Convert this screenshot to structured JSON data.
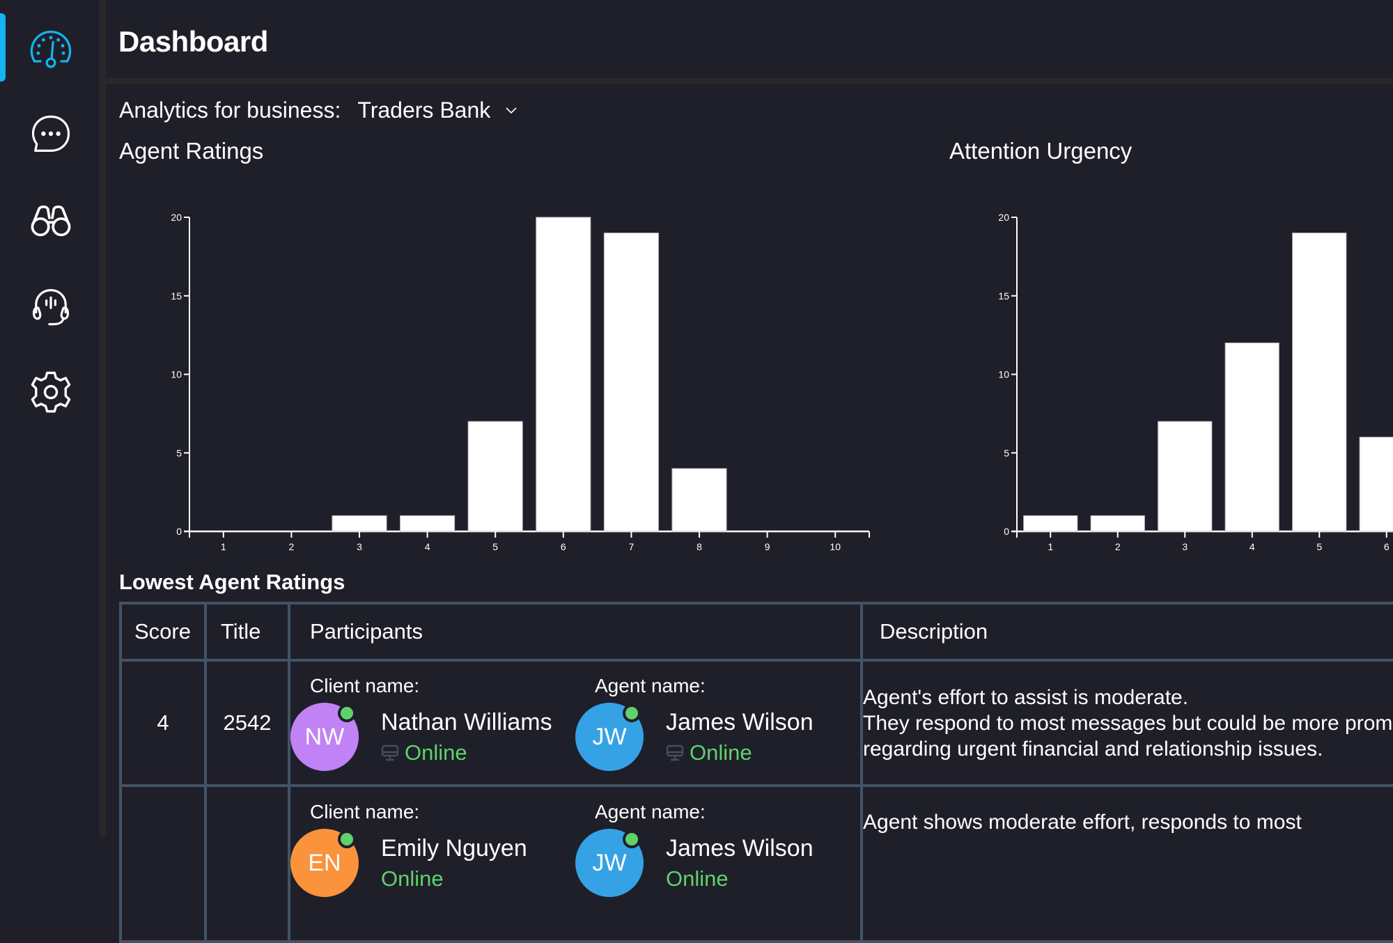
{
  "sidebar": {
    "items": [
      {
        "name": "dashboard",
        "icon": "speedometer-icon",
        "active": true
      },
      {
        "name": "chats",
        "icon": "chat-bubble-icon",
        "active": false
      },
      {
        "name": "monitor",
        "icon": "binoculars-icon",
        "active": false
      },
      {
        "name": "agents",
        "icon": "headset-icon",
        "active": false
      },
      {
        "name": "settings",
        "icon": "gear-icon",
        "active": false
      }
    ],
    "accent_color": "#12b5ef"
  },
  "header": {
    "title": "Dashboard"
  },
  "business": {
    "label": "Analytics for business:",
    "selected": "Traders Bank"
  },
  "charts": {
    "agent_ratings_title": "Agent Ratings",
    "attention_urgency_title": "Attention Urgency"
  },
  "chart_data": [
    {
      "type": "bar",
      "title": "Agent Ratings",
      "categories": [
        "1",
        "2",
        "3",
        "4",
        "5",
        "6",
        "7",
        "8",
        "9",
        "10"
      ],
      "values": [
        0,
        0,
        1,
        1,
        7,
        20,
        19,
        4,
        0,
        0
      ],
      "xlabel": "",
      "ylabel": "",
      "ylim": [
        0,
        20
      ],
      "yticks": [
        0,
        5,
        10,
        15,
        20
      ],
      "grid": false,
      "bar_color": "#ffffff"
    },
    {
      "type": "bar",
      "title": "Attention Urgency",
      "categories": [
        "1",
        "2",
        "3",
        "4",
        "5",
        "6"
      ],
      "values": [
        1,
        1,
        7,
        12,
        19,
        6
      ],
      "xlabel": "",
      "ylabel": "",
      "ylim": [
        0,
        20
      ],
      "yticks": [
        0,
        5,
        10,
        15,
        20
      ],
      "grid": false,
      "bar_color": "#ffffff",
      "note": "chart truncated at right edge; only categories 1-6 visible"
    }
  ],
  "table": {
    "title": "Lowest Agent Ratings",
    "columns": [
      "Score",
      "Title",
      "Participants",
      "Description"
    ],
    "client_label": "Client name:",
    "agent_label": "Agent name:",
    "rows": [
      {
        "score": "4",
        "title": "2542",
        "client": {
          "name": "Nathan Williams",
          "initials": "NW",
          "color": "#c182f6",
          "status": "Online"
        },
        "agent": {
          "name": "James Wilson",
          "initials": "JW",
          "color": "#35a2e6",
          "status": "Online"
        },
        "description": "Agent's effort to assist is moderate.\nThey respond to most messages but could be more prompt, especially regarding urgent financial and relationship issues."
      },
      {
        "score": "",
        "title": "",
        "client": {
          "name": "Emily Nguyen",
          "initials": "EN",
          "color": "#fb923c",
          "status": "Online"
        },
        "agent": {
          "name": "James Wilson",
          "initials": "JW",
          "color": "#35a2e6",
          "status": "Online"
        },
        "description": "Agent shows moderate effort, responds to most"
      }
    ],
    "status_color": "#5fd26b"
  }
}
